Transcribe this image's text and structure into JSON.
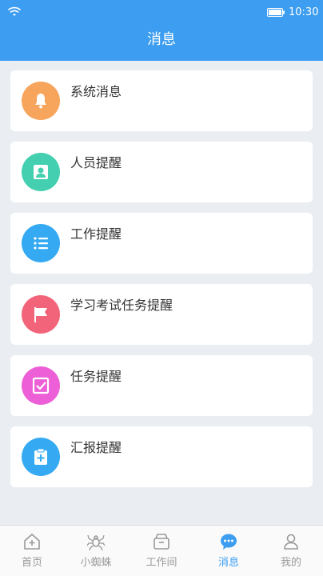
{
  "status_bar": {
    "time": "10:30",
    "wifi_icon": "wifi-icon",
    "battery_icon": "battery-icon"
  },
  "header": {
    "title": "消息"
  },
  "messages": [
    {
      "label": "系统消息",
      "icon": "bell-icon",
      "color": "#f7a45c"
    },
    {
      "label": "人员提醒",
      "icon": "user-icon",
      "color": "#43cfb0"
    },
    {
      "label": "工作提醒",
      "icon": "list-icon",
      "color": "#35aaf2"
    },
    {
      "label": "学习考试任务提醒",
      "icon": "flag-icon",
      "color": "#f2647a"
    },
    {
      "label": "任务提醒",
      "icon": "checkbox-icon",
      "color": "#ec5fd6"
    },
    {
      "label": "汇报提醒",
      "icon": "clipboard-plus-icon",
      "color": "#35aaf2"
    }
  ],
  "tabs": [
    {
      "label": "首页",
      "icon": "home-icon",
      "active": false
    },
    {
      "label": "小蜘蛛",
      "icon": "spider-icon",
      "active": false
    },
    {
      "label": "工作间",
      "icon": "workspace-icon",
      "active": false
    },
    {
      "label": "消息",
      "icon": "chat-bubble-icon",
      "active": true
    },
    {
      "label": "我的",
      "icon": "person-icon",
      "active": false
    }
  ],
  "colors": {
    "primary": "#3d9df0",
    "background": "#eaeef2",
    "tab_inactive": "#999999"
  }
}
